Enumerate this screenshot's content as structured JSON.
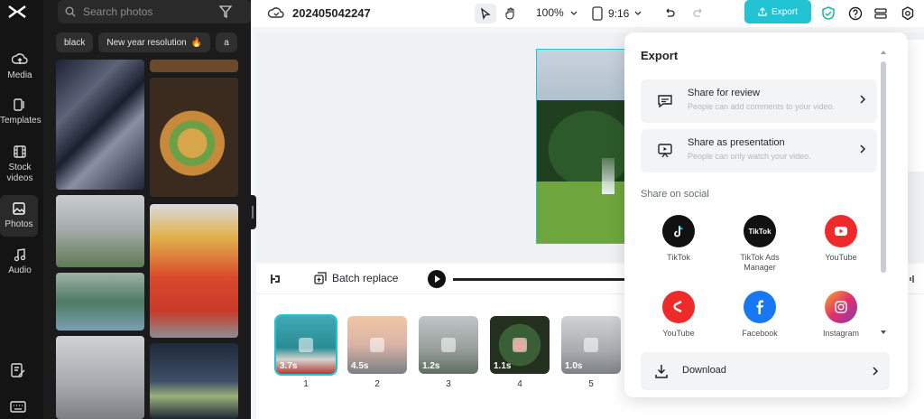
{
  "rail": {
    "items": [
      {
        "label": "Media",
        "icon": "cloud-upload-icon"
      },
      {
        "label": "Templates",
        "icon": "templates-icon"
      },
      {
        "label": "Stock videos",
        "icon": "film-icon"
      },
      {
        "label": "Photos",
        "icon": "image-icon"
      },
      {
        "label": "Audio",
        "icon": "music-note-icon"
      }
    ]
  },
  "panel": {
    "search_placeholder": "Search photos",
    "chips": [
      "black",
      "New year resolution",
      "a"
    ]
  },
  "topbar": {
    "project_title": "202405042247",
    "zoom": "100%",
    "ratio": "9:16",
    "export_label": "Export"
  },
  "toolbar": {
    "batch_replace": "Batch replace"
  },
  "timeline": {
    "clips": [
      {
        "duration": "3.7s",
        "number": "1"
      },
      {
        "duration": "4.5s",
        "number": "2"
      },
      {
        "duration": "1.2s",
        "number": "3"
      },
      {
        "duration": "1.1s",
        "number": "4"
      },
      {
        "duration": "1.0s",
        "number": "5"
      }
    ]
  },
  "export_panel": {
    "title": "Export",
    "options": [
      {
        "title": "Share for review",
        "subtitle": "People can add comments to your video."
      },
      {
        "title": "Share as presentation",
        "subtitle": "People can only watch your video."
      }
    ],
    "social_heading": "Share on social",
    "socials": [
      {
        "label": "TikTok",
        "color": "#111111"
      },
      {
        "label": "TikTok Ads Manager",
        "color": "#111111"
      },
      {
        "label": "YouTube",
        "color": "#ee2a2a"
      },
      {
        "label": "YouTube",
        "color": "#ee2a2a"
      },
      {
        "label": "Facebook",
        "color": "#1877f2"
      },
      {
        "label": "Instagram",
        "color": "#c13584"
      }
    ],
    "download_label": "Download"
  },
  "colors": {
    "accent": "#22c4d4",
    "rail_bg": "#141414",
    "panel_bg": "#1b1b1b"
  }
}
